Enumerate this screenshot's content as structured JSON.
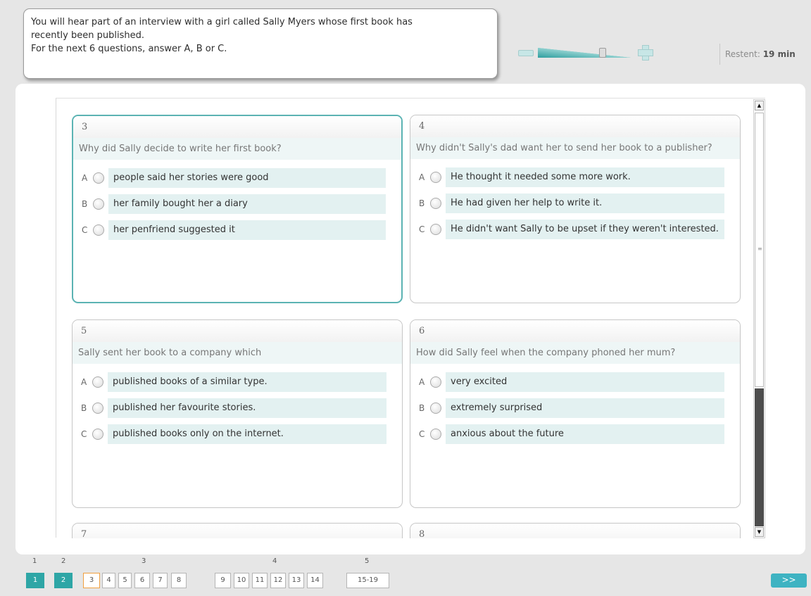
{
  "instructions": {
    "line1": "You will hear part of an interview with a girl called Sally Myers whose first book has",
    "line2": "recently been published.",
    "line3": "For the next 6 questions, answer A, B or C."
  },
  "volume": {
    "level": 0.7
  },
  "timer": {
    "label": "Restent:",
    "value": "19 min"
  },
  "questions": [
    {
      "number": "3",
      "text": "Why did Sally decide to write her first book?",
      "options": [
        {
          "letter": "A",
          "text": "people said her stories were good"
        },
        {
          "letter": "B",
          "text": "her family bought her a diary"
        },
        {
          "letter": "C",
          "text": "her penfriend suggested it"
        }
      ]
    },
    {
      "number": "4",
      "text": "Why didn't Sally's dad want her to send her book to a publisher?",
      "options": [
        {
          "letter": "A",
          "text": "He thought it needed some more work."
        },
        {
          "letter": "B",
          "text": "He had given her help to write it."
        },
        {
          "letter": "C",
          "text": "He didn't want Sally to be upset if they weren't interested."
        }
      ]
    },
    {
      "number": "5",
      "text": "Sally sent her book to a company which",
      "options": [
        {
          "letter": "A",
          "text": "published books of a similar type."
        },
        {
          "letter": "B",
          "text": "published her favourite stories."
        },
        {
          "letter": "C",
          "text": "published books only on the internet."
        }
      ]
    },
    {
      "number": "6",
      "text": "How did Sally feel when the company phoned her mum?",
      "options": [
        {
          "letter": "A",
          "text": "very excited"
        },
        {
          "letter": "B",
          "text": "extremely surprised"
        },
        {
          "letter": "C",
          "text": "anxious about the future"
        }
      ]
    },
    {
      "number": "7"
    },
    {
      "number": "8"
    }
  ],
  "nav": {
    "sections": [
      "1",
      "2",
      "3",
      "4",
      "5"
    ],
    "pages": [
      "1",
      "2",
      "3",
      "4",
      "5",
      "6",
      "7",
      "8",
      "9",
      "10",
      "11",
      "12",
      "13",
      "14",
      "15-19"
    ],
    "next_label": ">>"
  }
}
